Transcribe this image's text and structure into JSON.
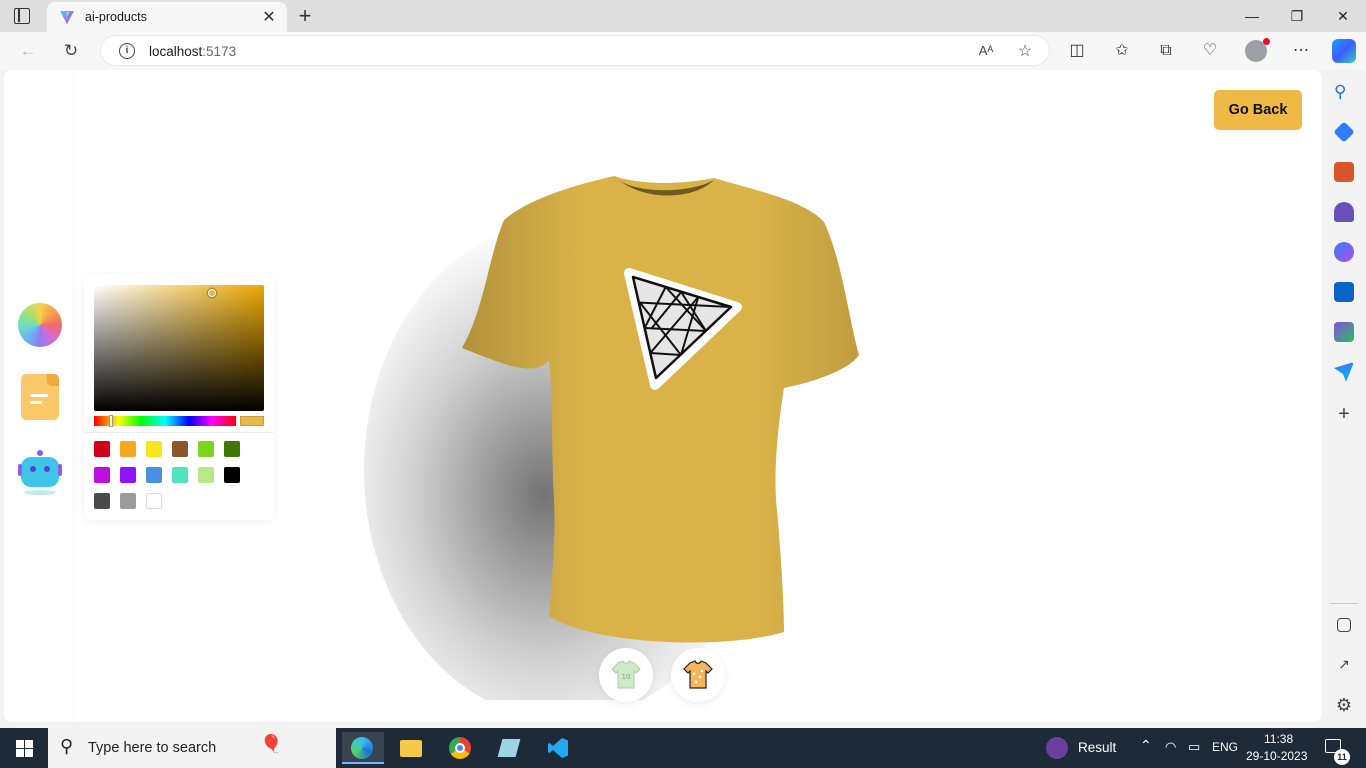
{
  "browser": {
    "tab_title": "ai-products",
    "url_host": "localhost",
    "url_port": ":5173"
  },
  "page": {
    "go_back_label": "Go Back",
    "color_picker": {
      "selected_color": "#e8b94a",
      "swatches": [
        "#d0021b",
        "#f5a623",
        "#f8e71c",
        "#8b572a",
        "#7ed321",
        "#417505",
        "#bd10e0",
        "#9013fe",
        "#4a90e2",
        "#50e3c2",
        "#b8e986",
        "#000000",
        "#4a4a4a",
        "#9b9b9b",
        "#ffffff"
      ]
    },
    "shirt_color": "#d9b248"
  },
  "taskbar": {
    "search_placeholder": "Type here to search",
    "weather_label": "Result",
    "language": "ENG",
    "time": "11:38",
    "date": "29-10-2023",
    "notification_count": "11"
  }
}
